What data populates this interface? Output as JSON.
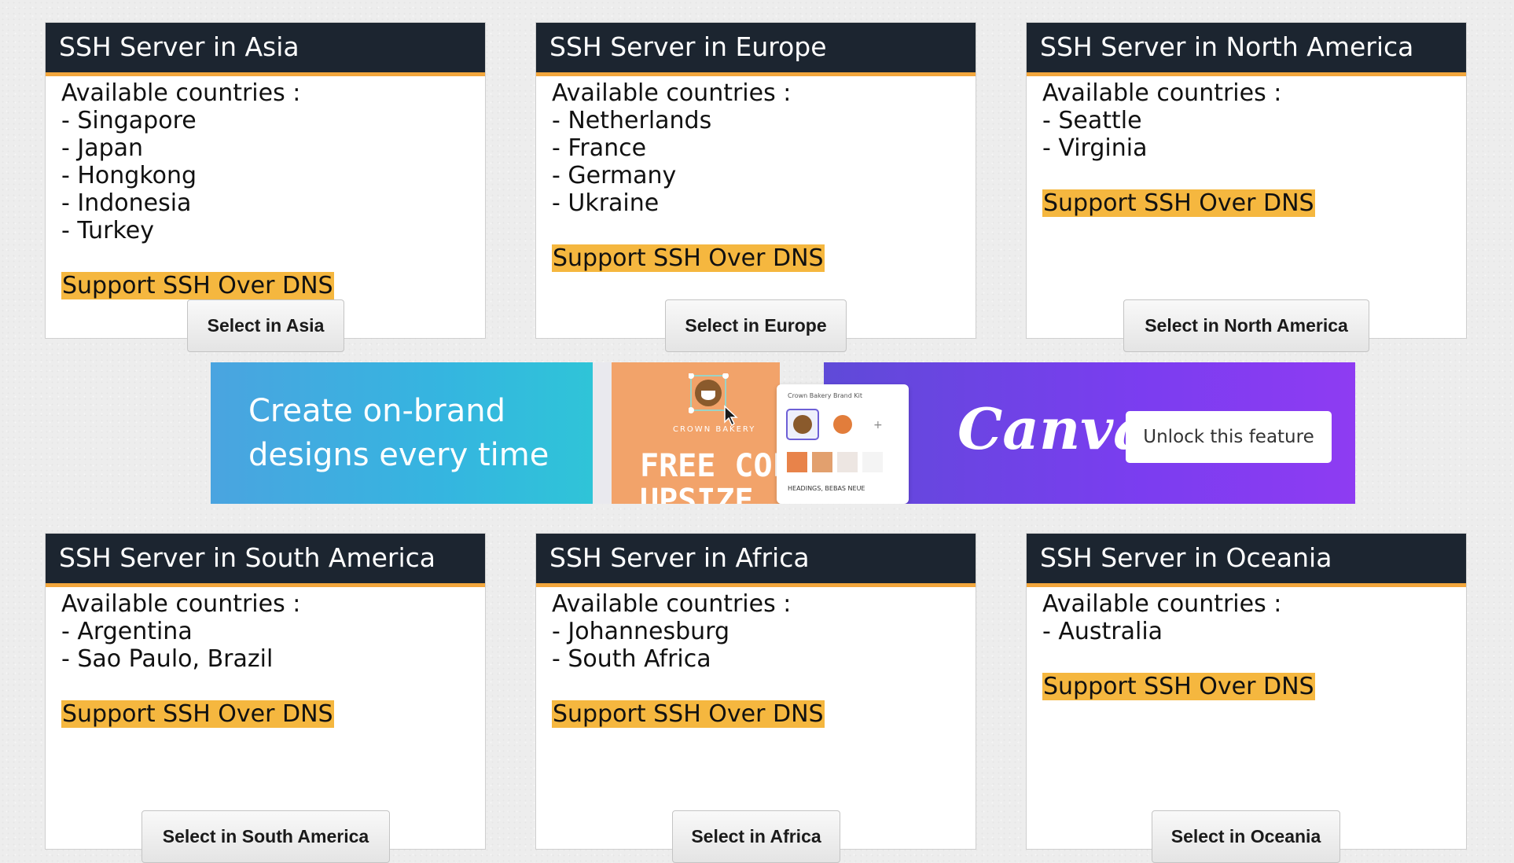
{
  "cards": [
    {
      "title": "SSH Server in Asia",
      "intro": "Available countries :",
      "countries": [
        "- Singapore",
        "- Japan",
        "- Hongkong",
        "- Indonesia",
        "- Turkey"
      ],
      "badge": "Support SSH Over DNS",
      "button": "Select in Asia"
    },
    {
      "title": "SSH Server in Europe",
      "intro": "Available countries :",
      "countries": [
        "- Netherlands",
        "- France",
        "- Germany",
        "- Ukraine"
      ],
      "badge": "Support SSH Over DNS",
      "button": "Select in Europe"
    },
    {
      "title": "SSH Server in North America",
      "intro": "Available countries :",
      "countries": [
        "- Seattle",
        "- Virginia"
      ],
      "badge": "Support SSH Over DNS",
      "button": "Select in North America"
    },
    {
      "title": "SSH Server in South America",
      "intro": "Available countries :",
      "countries": [
        "- Argentina",
        "- Sao Paulo, Brazil"
      ],
      "badge": "Support SSH Over DNS",
      "button": "Select in South America"
    },
    {
      "title": "SSH Server in Africa",
      "intro": "Available countries :",
      "countries": [
        "- Johannesburg",
        "- South Africa"
      ],
      "badge": "Support SSH Over DNS",
      "button": "Select in Africa"
    },
    {
      "title": "SSH Server in Oceania",
      "intro": "Available countries :",
      "countries": [
        "- Australia"
      ],
      "badge": "Support SSH Over DNS",
      "button": "Select in Oceania"
    }
  ],
  "ad": {
    "headline_line1": "Create on-brand",
    "headline_line2": "designs every time",
    "bakery_label": "CROWN BAKERY",
    "promo_line1": "FREE COFFEE",
    "promo_line2": "UPSIZE",
    "panel_title": "Crown Bakery Brand Kit",
    "panel_fonts": "HEADINGS, BEBAS NEUE",
    "brand": "Canva",
    "cta": "Unlock this feature"
  },
  "colors": {
    "header_bg": "#1c2530",
    "accent_orange": "#f2a63c",
    "badge_bg": "#f5b73f",
    "page_bg": "#ededed"
  },
  "icons": [
    "coffee-cup-icon",
    "mouse-pointer-icon",
    "plus-icon"
  ]
}
